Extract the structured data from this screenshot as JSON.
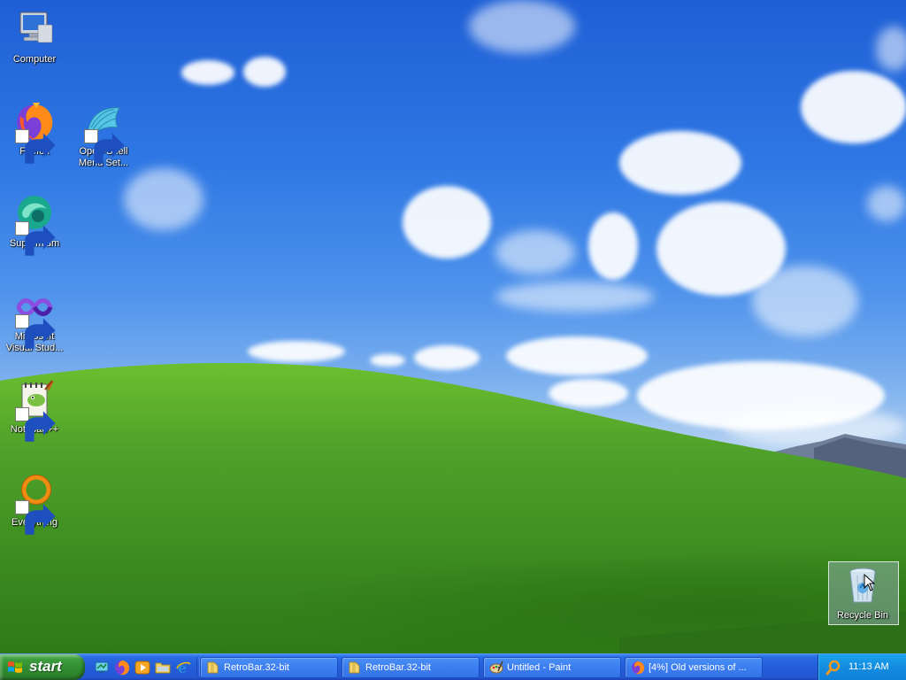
{
  "desktop": {
    "icons": [
      {
        "label": "Computer",
        "icon": "computer-icon",
        "shortcut": false
      },
      {
        "label": "Firefox",
        "icon": "firefox-icon",
        "shortcut": true
      },
      {
        "label": "Open-Shell Menu Set...",
        "label_line1": "Open-Shell",
        "label_line2": "Menu Set...",
        "icon": "open-shell-icon",
        "shortcut": true
      },
      {
        "label": "Supermium",
        "icon": "supermium-icon",
        "shortcut": true
      },
      {
        "label": "Microsoft Visual Stud...",
        "label_line1": "Microsoft",
        "label_line2": "Visual Stud...",
        "icon": "visual-studio-icon",
        "shortcut": true
      },
      {
        "label": "Notepad++",
        "icon": "notepad-plus-plus-icon",
        "shortcut": true
      },
      {
        "label": "Everything",
        "icon": "everything-icon",
        "shortcut": true
      },
      {
        "label": "Recycle Bin",
        "icon": "recycle-bin-icon",
        "shortcut": false,
        "selected": true
      }
    ]
  },
  "taskbar": {
    "start_label": "start",
    "quick_launch": [
      "show-desktop-icon",
      "firefox-icon",
      "media-player-icon",
      "explorer-folder-icon",
      "internet-explorer-icon"
    ],
    "tasks": [
      {
        "label": "RetroBar.32-bit",
        "icon": "folder-icon"
      },
      {
        "label": "RetroBar.32-bit",
        "icon": "folder-icon"
      },
      {
        "label": "Untitled - Paint",
        "icon": "paint-icon"
      },
      {
        "label": "[4%] Old versions of ...",
        "icon": "firefox-icon"
      }
    ],
    "tray": {
      "icon": "search-icon",
      "clock": "11:13 AM"
    }
  },
  "colors": {
    "taskbar_blue": "#245dd9",
    "start_green": "#3d9d3d",
    "tray_blue": "#138ce0",
    "sky_top": "#1f5fd6",
    "grass": "#4fa12a"
  }
}
